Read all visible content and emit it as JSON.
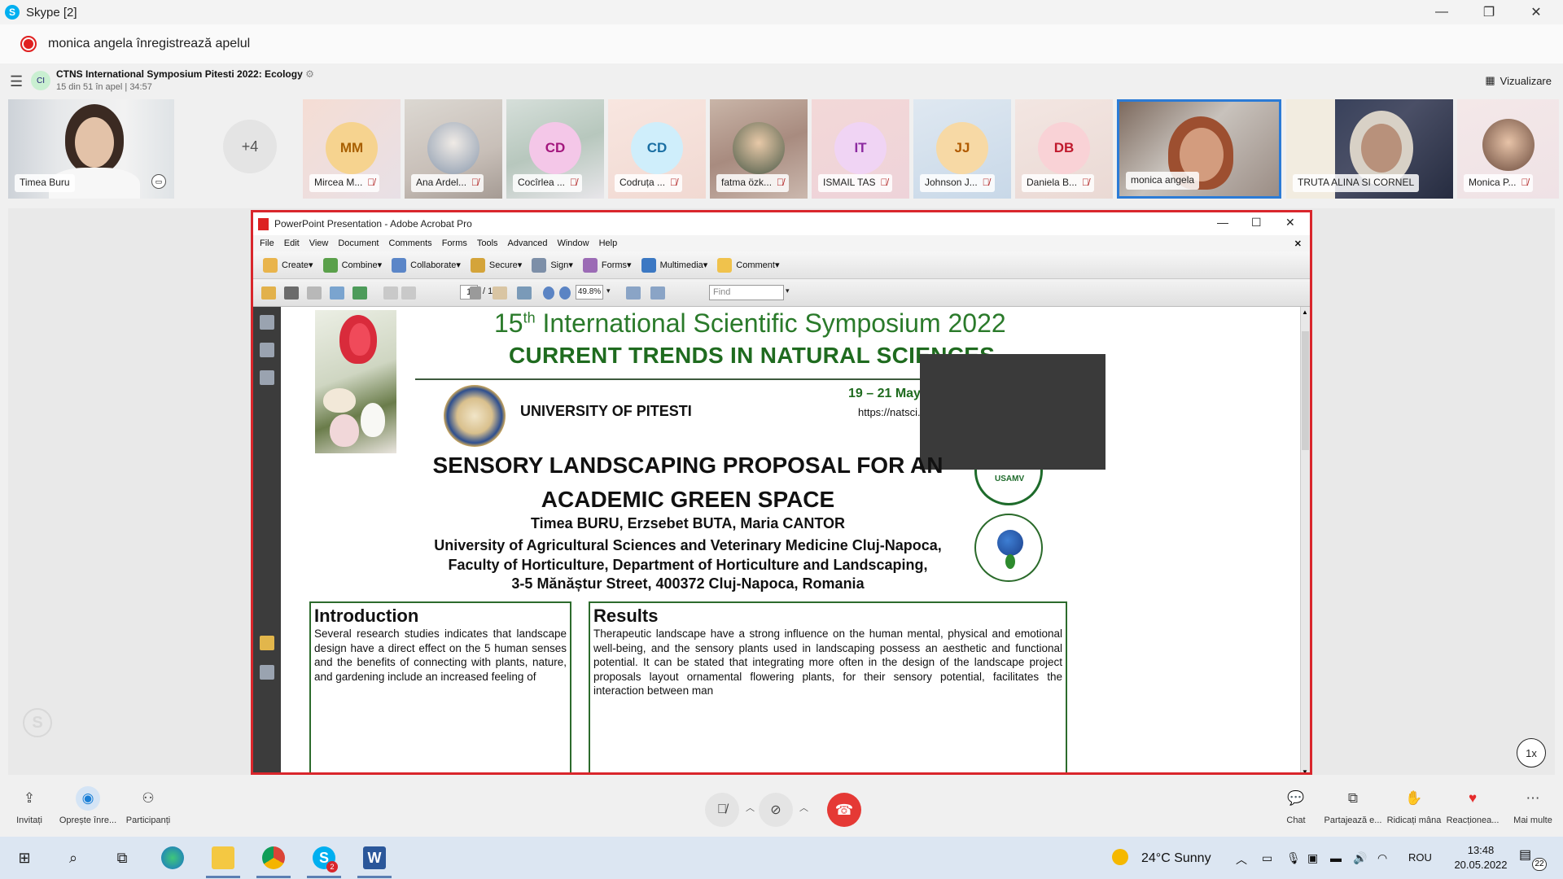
{
  "window": {
    "title": "Skype [2]",
    "minimize_glyph": "—",
    "maximize_glyph": "❐",
    "close_glyph": "✕"
  },
  "recording": {
    "text": "monica angela înregistrează apelul"
  },
  "call": {
    "name": "CTNS International Symposium Pitesti 2022: Ecology",
    "avatar_initials": "CI",
    "subtitle": "15 din 51 în apel | 34:57",
    "view_label": "Vizualizare"
  },
  "participants": {
    "self_name": "Timea Buru",
    "more_count": "+4",
    "tiles": [
      {
        "initials": "MM",
        "name": "Mircea M...",
        "color": "#f6d38f"
      },
      {
        "initials": "",
        "name": "Ana Ardel...",
        "color": "#d9dde4"
      },
      {
        "initials": "CD",
        "name": "Cocîrlea ...",
        "color": "#f4c7e8"
      },
      {
        "initials": "CD",
        "name": "Codruța ...",
        "color": "#cfeefb"
      },
      {
        "initials": "",
        "name": "fatma özk...",
        "color": "#9bb0c7"
      },
      {
        "initials": "IT",
        "name": "ISMAIL TAS",
        "color": "#f0d4f4"
      },
      {
        "initials": "JJ",
        "name": "Johnson J...",
        "color": "#f7d9a5"
      },
      {
        "initials": "DB",
        "name": "Daniela B...",
        "color": "#f9d2d6"
      }
    ],
    "speaker_name": "monica angela",
    "truta_name": "TRUTA ALINA SI CORNEL",
    "last_name": "Monica P..."
  },
  "acrobat": {
    "title": "PowerPoint Presentation - Adobe Acrobat Pro",
    "menu": [
      "File",
      "Edit",
      "View",
      "Document",
      "Comments",
      "Forms",
      "Tools",
      "Advanced",
      "Window",
      "Help"
    ],
    "toolbar": [
      "Create",
      "Combine",
      "Collaborate",
      "Secure",
      "Sign",
      "Forms",
      "Multimedia",
      "Comment"
    ],
    "page_current": "1",
    "page_total": "/ 1",
    "zoom": "49.8%",
    "find_placeholder": "Find"
  },
  "poster": {
    "symposium_num": "15",
    "symposium_sup": "th",
    "symposium_title": " International Scientific Symposium 2022",
    "subtitle": "CURRENT TRENDS IN NATURAL SCIENCES",
    "university": "UNIVERSITY OF PITESTI",
    "dates": "19 – 21 May,",
    "site": "https://natsci.u",
    "title_line1": "SENSORY LANDSCAPING PROPOSAL FOR AN",
    "title_line2": "ACADEMIC GREEN SPACE",
    "authors": "Timea BURU, Erzsebet BUTA, Maria CANTOR",
    "affil_line1": "University of Agricultural Sciences and Veterinary Medicine Cluj-Napoca,",
    "affil_line2": "Faculty of Horticulture, Department of Horticulture and Landscaping,",
    "affil_line3": "3-5 Mănăștur Street, 400372 Cluj-Napoca, Romania",
    "usamv": "USAMV",
    "intro_heading": "Introduction",
    "intro_text": "Several research studies indicates that landscape design have a direct effect on the 5 human senses and the benefits of connecting with plants, nature, and gardening include an increased feeling of",
    "results_heading": "Results",
    "results_text": "Therapeutic landscape have a strong influence on the human mental, physical and emotional well-being, and the sensory plants used in landscaping possess an aesthetic and functional potential. It can be stated that integrating more often in the design of the landscape project proposals layout ornamental flowering plants, for their sensory potential, facilitates the interaction between man"
  },
  "stage": {
    "speed": "1x"
  },
  "controls": {
    "invite": "Invitați",
    "stop_recording": "Oprește înre...",
    "participants": "Participanți",
    "chat": "Chat",
    "share": "Partajează e...",
    "raise_hand": "Ridicați mâna",
    "react": "Reacționea...",
    "more": "Mai multe"
  },
  "taskbar": {
    "weather": "24°C  Sunny",
    "lang": "ROU",
    "time": "13:48",
    "date": "20.05.2022",
    "notifications": "22",
    "skype_badge": "2"
  }
}
